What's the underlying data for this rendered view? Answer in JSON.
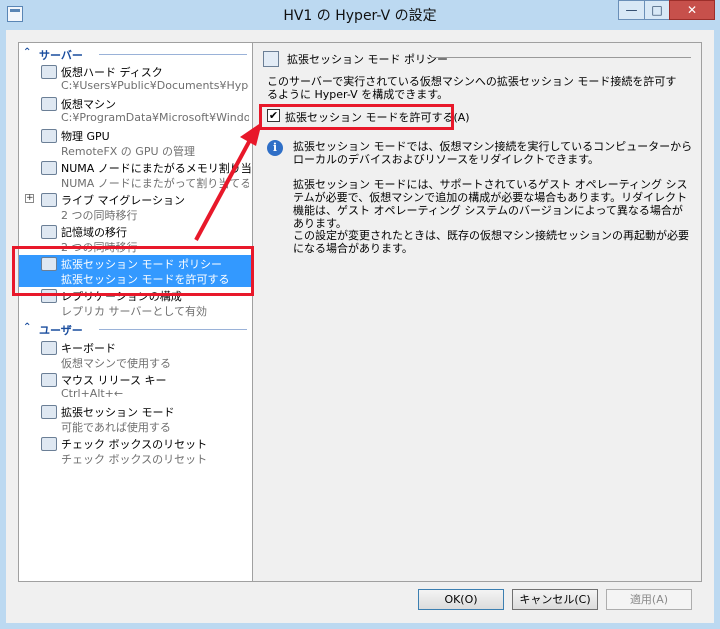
{
  "window": {
    "title": "HV1 の Hyper-V の設定",
    "controls": {
      "minimize": "—",
      "maximize": "□",
      "close": "✕"
    }
  },
  "sidebar": {
    "server_section": "サーバー",
    "user_section": "ユーザー",
    "items": [
      {
        "label": "仮想ハード ディスク",
        "sub": "C:¥Users¥Public¥Documents¥Hype...",
        "icon": "folder-icon"
      },
      {
        "label": "仮想マシン",
        "sub": "C:¥ProgramData¥Microsoft¥Windo...",
        "icon": "folder-vm-icon"
      },
      {
        "label": "物理 GPU",
        "sub": "RemoteFX の GPU の管理",
        "icon": "gpu-icon"
      },
      {
        "label": "NUMA ノードにまたがるメモリ割り当て",
        "sub": "NUMA ノードにまたがって割り当てる",
        "icon": "numa-icon"
      },
      {
        "label": "ライブ マイグレーション",
        "sub": "2 つの同時移行",
        "icon": "migration-icon",
        "expander": "+"
      },
      {
        "label": "記憶域の移行",
        "sub": "2 つの同時移行",
        "icon": "storage-migration-icon"
      },
      {
        "label": "拡張セッション モード ポリシー",
        "sub": "拡張セッション モードを許可する",
        "icon": "enhanced-session-policy-icon",
        "selected": true
      },
      {
        "label": "レプリケーションの構成",
        "sub": "レプリカ サーバーとして有効",
        "icon": "replication-icon"
      }
    ],
    "user_items": [
      {
        "label": "キーボード",
        "sub": "仮想マシンで使用する",
        "icon": "keyboard-icon"
      },
      {
        "label": "マウス リリース キー",
        "sub": "Ctrl+Alt+←",
        "icon": "mouse-icon"
      },
      {
        "label": "拡張セッション モード",
        "sub": "可能であれば使用する",
        "icon": "enhanced-session-icon"
      },
      {
        "label": "チェック ボックスのリセット",
        "sub": "チェック ボックスのリセット",
        "icon": "checkbox-reset-icon"
      }
    ]
  },
  "main": {
    "heading": "拡張セッション モード ポリシー",
    "description": "このサーバーで実行されている仮想マシンへの拡張セッション モード接続を許可するように Hyper-V を構成できます。",
    "checkbox_label": "拡張セッション モードを許可する(A)",
    "checkbox_checked": "✔",
    "info_icon": "i",
    "info_paragraphs": [
      "拡張セッション モードでは、仮想マシン接続を実行しているコンピューターからローカルのデバイスおよびリソースをリダイレクトできます。",
      "拡張セッション モードには、サポートされているゲスト オペレーティング システムが必要で、仮想マシンで追加の構成が必要な場合もあります。リダイレクト機能は、ゲスト オペレーティング システムのバージョンによって異なる場合があります。",
      "この設定が変更されたときは、既存の仮想マシン接続セッションの再起動が必要になる場合があります。"
    ]
  },
  "footer": {
    "ok": "OK(O)",
    "cancel": "キャンセル(C)",
    "apply": "適用(A)"
  },
  "colors": {
    "highlight": "#e8182a",
    "selection": "#3399ff",
    "section_title": "#1a4d9e"
  }
}
